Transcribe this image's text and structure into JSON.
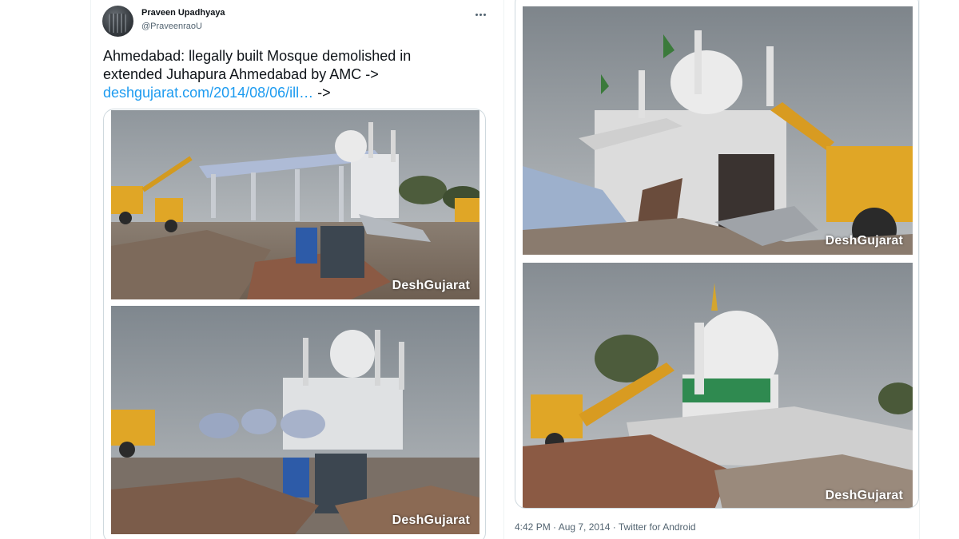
{
  "tweet": {
    "display_name": "Praveen Upadhyaya",
    "handle": "@PraveenraoU",
    "text_line1": "Ahmedabad: llegally built Mosque demolished in",
    "text_line2": "extended Juhapura Ahmedabad by AMC ->",
    "link_text": "deshgujarat.com/2014/08/06/ill…",
    "link_suffix": " ->",
    "timestamp": "4:42 PM · Aug 7, 2014 · Twitter for Android"
  },
  "media": {
    "watermark": "DeshGujarat",
    "photos": [
      {
        "id": "photo-1",
        "watermark": "DeshGujarat"
      },
      {
        "id": "photo-2",
        "watermark": "DeshGujarat"
      },
      {
        "id": "photo-3",
        "watermark": "DeshGujarat"
      },
      {
        "id": "photo-4",
        "watermark": "DeshGujarat"
      }
    ]
  },
  "icons": {
    "more": "more-horizontal-icon"
  },
  "colors": {
    "link": "#1d9bf0",
    "text": "#0f1419",
    "muted": "#536471",
    "border": "#cfd9de"
  }
}
